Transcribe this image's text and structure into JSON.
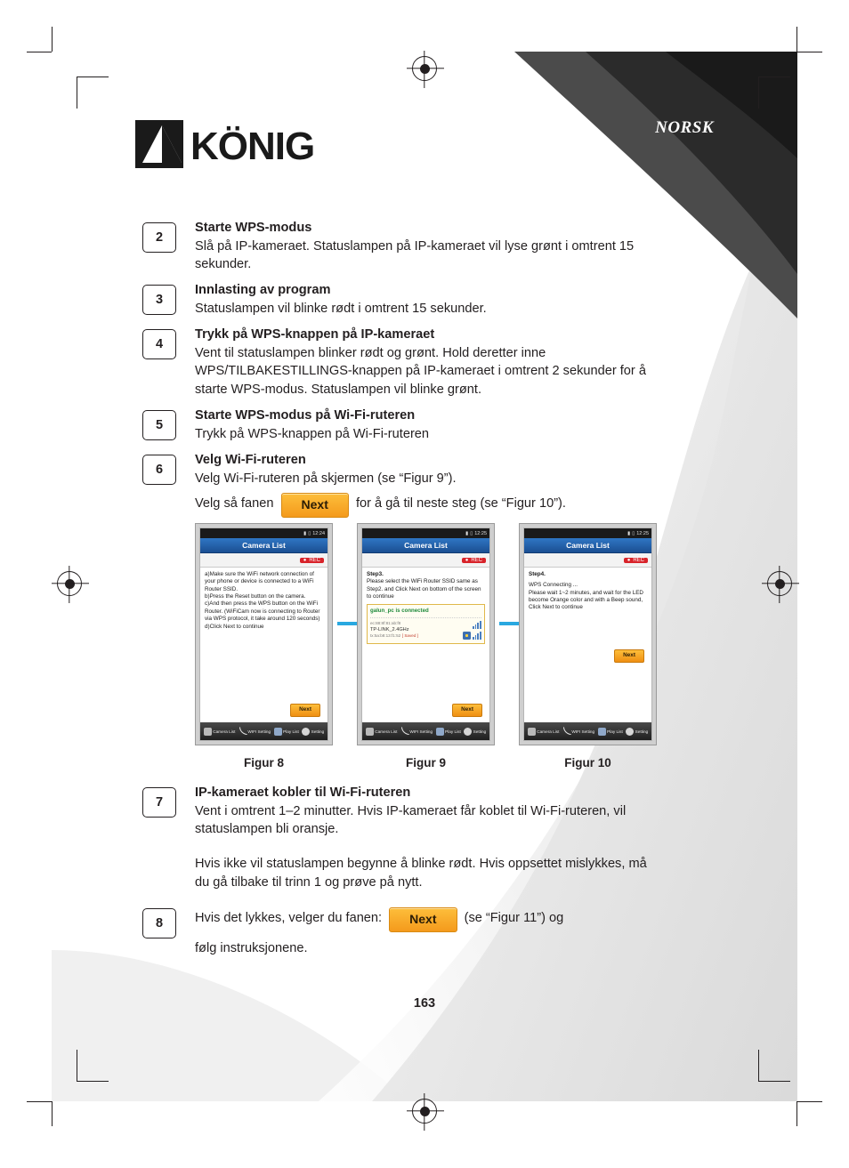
{
  "document": {
    "language_label": "NORSK",
    "brand": "KÖNIG",
    "page_number": "163"
  },
  "steps": [
    {
      "num": "2",
      "title": "Starte WPS-modus",
      "text": "Slå på IP-kameraet. Statuslampen på IP-kameraet vil lyse grønt i omtrent 15 sekunder."
    },
    {
      "num": "3",
      "title": "Innlasting av program",
      "text": "Statuslampen vil blinke rødt i omtrent 15 sekunder."
    },
    {
      "num": "4",
      "title": "Trykk på WPS-knappen på IP-kameraet",
      "text": "Vent til statuslampen blinker rødt og grønt. Hold deretter inne WPS/TILBAKESTILLINGS-knappen på IP-kameraet i omtrent 2 sekunder for å starte WPS-modus. Statuslampen vil blinke grønt."
    },
    {
      "num": "5",
      "title": "Starte WPS-modus på Wi-Fi-ruteren",
      "text": "Trykk på WPS-knappen på Wi-Fi-ruteren"
    },
    {
      "num": "6",
      "title": "Velg Wi-Fi-ruteren",
      "text": "Velg Wi-Fi-ruteren på skjermen (se “Figur 9”).",
      "line2_before": "Velg så fanen",
      "line2_button": "Next",
      "line2_after": "for å gå til neste steg (se “Figur 10”)."
    },
    {
      "num": "7",
      "title": "IP-kameraet kobler til Wi-Fi-ruteren",
      "text": "Vent i omtrent 1–2 minutter. Hvis IP-kameraet får koblet til Wi-Fi-ruteren, vil statuslampen bli oransje.",
      "text2": "Hvis ikke vil statuslampen begynne å blinke rødt. Hvis oppsettet mislykkes, må du gå tilbake til trinn 1 og prøve på nytt."
    },
    {
      "num": "8",
      "line1_before": "Hvis det lykkes, velger du fanen:",
      "line1_button": "Next",
      "line1_after": "(se “Figur 11”) og",
      "line2": "følg instruksjonene."
    }
  ],
  "figures": [
    {
      "caption": "Figur 8",
      "status_time": "12:24",
      "title": "Camera List",
      "rec_label": "REC",
      "body_lines": [
        "a)Make sure the WiFi network connection of your phone or device is connected to a WiFi Router SSID.",
        "b)Press the Reset button on the camera.",
        "c)And then press the WPS button on the WiFi Router. (WiFiCam now is connecting to Router via WPS protocol, it take around 120 seconds)",
        "d)Click Next to continue"
      ],
      "next_label": "Next",
      "tabs": [
        "Camera List",
        "WIFI Setting",
        "Play List",
        "Setting"
      ]
    },
    {
      "caption": "Figur 9",
      "status_time": "12:25",
      "title": "Camera List",
      "rec_label": "REC",
      "step_label": "Step3.",
      "body_lines": [
        "Please select the WiFi Router SSID same as Step2. and Click Next on bottom of the screen to continue"
      ],
      "ssid_connected": "galun_pc is connected",
      "ssid_rows": [
        {
          "mac": "ec:88:8f:81:ab:f8",
          "name": "TP-LINK_2.4GHz",
          "extra": "tx:5a:b8:13:f1:52",
          "saved": "[ Saved ]"
        }
      ],
      "next_label": "Next",
      "tabs": [
        "Camera List",
        "WIFI Setting",
        "Play List",
        "Setting"
      ]
    },
    {
      "caption": "Figur 10",
      "status_time": "12:25",
      "title": "Camera List",
      "rec_label": "REC",
      "step_label": "Step4.",
      "body_lines": [
        "WPS Connecting ...",
        "Please wait 1~2 minutes, and wait for the LED become Orange color and with a Beep sound, Click Next to continue"
      ],
      "next_label": "Next",
      "tabs": [
        "Camera List",
        "WIFI Setting",
        "Play List",
        "Setting"
      ]
    }
  ],
  "colors": {
    "accent_orange": "#f49a1c",
    "brand_dark": "#231f20",
    "phone_title_blue": "#1b4f92",
    "rec_red": "#d8232a",
    "connected_green": "#1f8a3b",
    "arrow_blue": "#29a8e0"
  }
}
